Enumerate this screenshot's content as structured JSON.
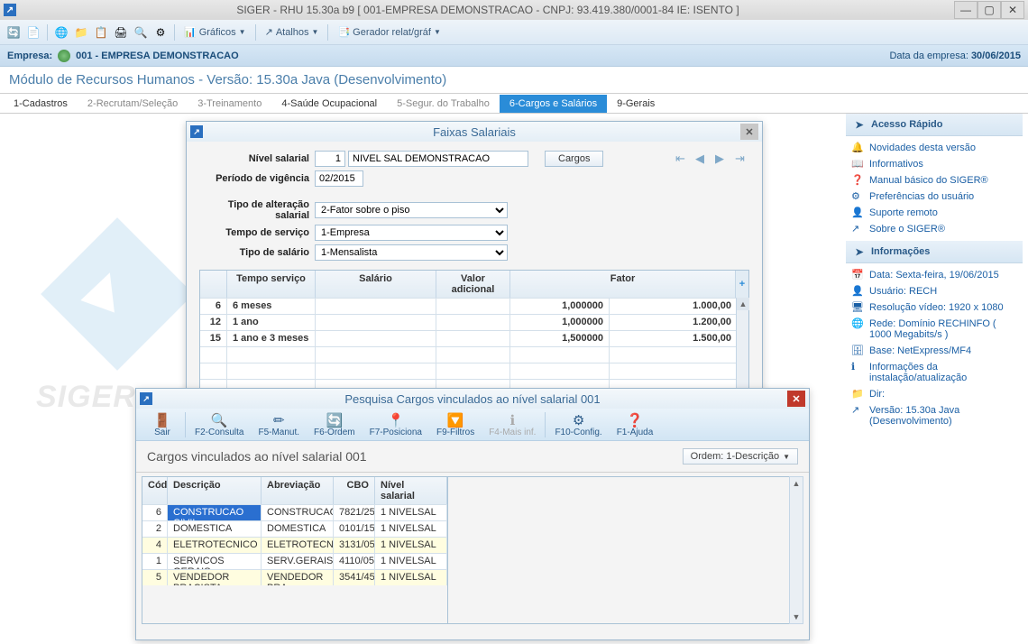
{
  "window": {
    "title": "SIGER - RHU 15.30a b9 [ 001-EMPRESA DEMONSTRACAO - CNPJ: 93.419.380/0001-84 IE: ISENTO ]"
  },
  "toolbar": {
    "graficos": "Gráficos",
    "atalhos": "Atalhos",
    "gerador": "Gerador relat/gráf"
  },
  "companybar": {
    "label": "Empresa:",
    "code": "001 - EMPRESA DEMONSTRACAO",
    "datelabel": "Data da empresa:",
    "date": "30/06/2015"
  },
  "module_title": "Módulo de Recursos Humanos - Versão: 15.30a Java (Desenvolvimento)",
  "tabs": [
    "1-Cadastros",
    "2-Recrutam/Seleção",
    "3-Treinamento",
    "4-Saúde Ocupacional",
    "5-Segur. do Trabalho",
    "6-Cargos e Salários",
    "9-Gerais"
  ],
  "quick_access": {
    "header": "Acesso Rápido",
    "items": [
      "Novidades desta versão",
      "Informativos",
      "Manual básico do SIGER®",
      "Preferências do usuário",
      "Suporte remoto",
      "Sobre o SIGER®"
    ]
  },
  "info": {
    "header": "Informações",
    "items": [
      "Data: Sexta-feira, 19/06/2015",
      "Usuário: RECH",
      "Resolução vídeo: 1920 x 1080",
      "Rede: Domínio RECHINFO ( 1000 Megabits/s )",
      "Base: NetExpress/MF4",
      "Informações da instalação/atualização",
      "Dir:",
      "Versão: 15.30a Java (Desenvolvimento)"
    ]
  },
  "dlg1": {
    "title": "Faixas Salariais",
    "labels": {
      "nivel": "Nível salarial",
      "periodo": "Período de vigência",
      "tipo_alt": "Tipo de alteração salarial",
      "tempo_serv": "Tempo de serviço",
      "tipo_sal": "Tipo de salário"
    },
    "values": {
      "nivel_cod": "1",
      "nivel_desc": "NIVEL SAL DEMONSTRACAO",
      "periodo": "02/2015",
      "tipo_alt": "2-Fator sobre o piso",
      "tempo_serv": "1-Empresa",
      "tipo_sal": "1-Mensalista"
    },
    "btn_cargos": "Cargos",
    "grid": {
      "headers": [
        "Tempo serviço",
        "Salário",
        "Valor adicional",
        "Fator"
      ],
      "rows": [
        {
          "n": "6",
          "tempo": "6 meses",
          "sal": "",
          "va": "",
          "fator_a": "1,000000",
          "fator_b": "1.000,00"
        },
        {
          "n": "12",
          "tempo": "1 ano",
          "sal": "",
          "va": "",
          "fator_a": "1,000000",
          "fator_b": "1.200,00"
        },
        {
          "n": "15",
          "tempo": "1 ano e 3 meses",
          "sal": "",
          "va": "",
          "fator_a": "1,500000",
          "fator_b": "1.500,00"
        }
      ]
    }
  },
  "dlg2": {
    "title": "Pesquisa Cargos vinculados ao nível salarial 001",
    "toolbar": [
      "Sair",
      "F2-Consulta",
      "F5-Manut.",
      "F6-Ordem",
      "F7-Posiciona",
      "F9-Filtros",
      "F4-Mais inf.",
      "F10-Config.",
      "F1-Ajuda"
    ],
    "subtitle": "Cargos vinculados ao nível salarial 001",
    "order": "Ordem: 1-Descrição",
    "grid": {
      "headers": [
        "Cód",
        "Descrição",
        "Abreviação",
        "CBO",
        "Nível salarial"
      ],
      "rows": [
        {
          "cod": "6",
          "desc": "CONSTRUCAO CIVIL",
          "abrev": "CONSTRUCAO",
          "cbo": "7821/25",
          "nivel": "1 NIVELSAL",
          "sel": true
        },
        {
          "cod": "2",
          "desc": "DOMESTICA",
          "abrev": "DOMESTICA",
          "cbo": "0101/15",
          "nivel": "1 NIVELSAL"
        },
        {
          "cod": "4",
          "desc": "ELETROTECNICO",
          "abrev": "ELETROTECNIC",
          "cbo": "3131/05",
          "nivel": "1 NIVELSAL",
          "hl": true
        },
        {
          "cod": "1",
          "desc": "SERVICOS GERAIS",
          "abrev": "SERV.GERAIS",
          "cbo": "4110/05",
          "nivel": "1 NIVELSAL"
        },
        {
          "cod": "5",
          "desc": "VENDEDOR PRACISTA",
          "abrev": "VENDEDOR PRA",
          "cbo": "3541/45",
          "nivel": "1 NIVELSAL",
          "hl": true
        }
      ]
    }
  },
  "bglogo_text": "SIGER"
}
